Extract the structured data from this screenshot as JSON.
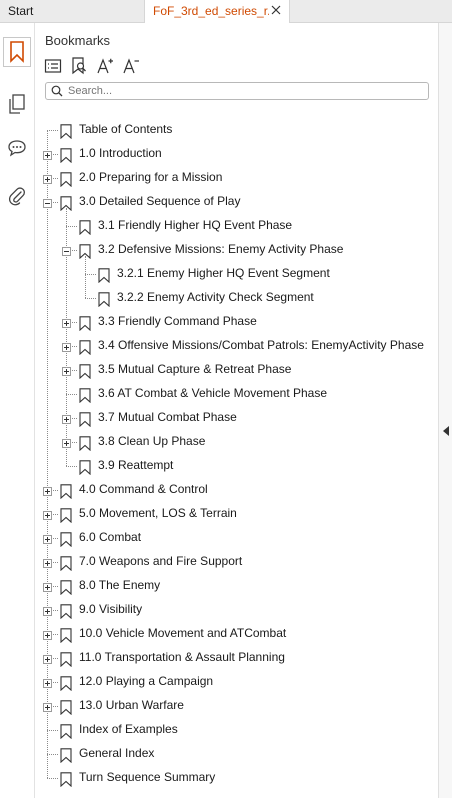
{
  "tabs": {
    "start": "Start",
    "document": "FoF_3rd_ed_series_r..."
  },
  "panel": {
    "title": "Bookmarks",
    "search_placeholder": "Search..."
  },
  "sidebar_icons": [
    "bookmark-icon",
    "pages-icon",
    "comment-icon",
    "attachment-icon"
  ],
  "toolbar_icons": [
    "options-list-icon",
    "find-bookmark-icon",
    "enlarge-text-icon",
    "reduce-text-icon"
  ],
  "bookmarks": [
    {
      "label": "Table of Contents",
      "level": 0,
      "toggle": ""
    },
    {
      "label": "1.0 Introduction",
      "level": 0,
      "toggle": "plus"
    },
    {
      "label": "2.0 Preparing for a Mission",
      "level": 0,
      "toggle": "plus"
    },
    {
      "label": "3.0 Detailed Sequence of Play",
      "level": 0,
      "toggle": "minus"
    },
    {
      "label": "3.1 Friendly Higher HQ Event Phase",
      "level": 1,
      "toggle": ""
    },
    {
      "label": "3.2 Defensive Missions: Enemy Activity Phase",
      "level": 1,
      "toggle": "minus"
    },
    {
      "label": "3.2.1 Enemy Higher HQ Event Segment",
      "level": 2,
      "toggle": ""
    },
    {
      "label": "3.2.2 Enemy Activity Check Segment",
      "level": 2,
      "toggle": ""
    },
    {
      "label": "3.3 Friendly Command Phase",
      "level": 1,
      "toggle": "plus"
    },
    {
      "label": "3.4 Offensive Missions/Combat Patrols: EnemyActivity Phase",
      "level": 1,
      "toggle": "plus"
    },
    {
      "label": "3.5 Mutual Capture & Retreat Phase",
      "level": 1,
      "toggle": "plus"
    },
    {
      "label": "3.6 AT Combat & Vehicle Movement Phase",
      "level": 1,
      "toggle": ""
    },
    {
      "label": "3.7 Mutual Combat Phase",
      "level": 1,
      "toggle": "plus"
    },
    {
      "label": "3.8 Clean Up Phase",
      "level": 1,
      "toggle": "plus"
    },
    {
      "label": "3.9 Reattempt",
      "level": 1,
      "toggle": ""
    },
    {
      "label": "4.0 Command & Control",
      "level": 0,
      "toggle": "plus"
    },
    {
      "label": "5.0 Movement, LOS & Terrain",
      "level": 0,
      "toggle": "plus"
    },
    {
      "label": "6.0 Combat",
      "level": 0,
      "toggle": "plus"
    },
    {
      "label": "7.0 Weapons and Fire Support",
      "level": 0,
      "toggle": "plus"
    },
    {
      "label": "8.0 The Enemy",
      "level": 0,
      "toggle": "plus"
    },
    {
      "label": "9.0 Visibility",
      "level": 0,
      "toggle": "plus"
    },
    {
      "label": "10.0 Vehicle Movement and ATCombat",
      "level": 0,
      "toggle": "plus"
    },
    {
      "label": "11.0 Transportation & Assault Planning",
      "level": 0,
      "toggle": "plus"
    },
    {
      "label": "12.0 Playing a Campaign",
      "level": 0,
      "toggle": "plus"
    },
    {
      "label": "13.0 Urban Warfare",
      "level": 0,
      "toggle": "plus"
    },
    {
      "label": "Index of Examples",
      "level": 0,
      "toggle": ""
    },
    {
      "label": "General Index",
      "level": 0,
      "toggle": ""
    },
    {
      "label": "Turn Sequence Summary",
      "level": 0,
      "toggle": ""
    }
  ],
  "colors": {
    "accent": "#d04a02",
    "tree_line": "#8a8a8a"
  }
}
